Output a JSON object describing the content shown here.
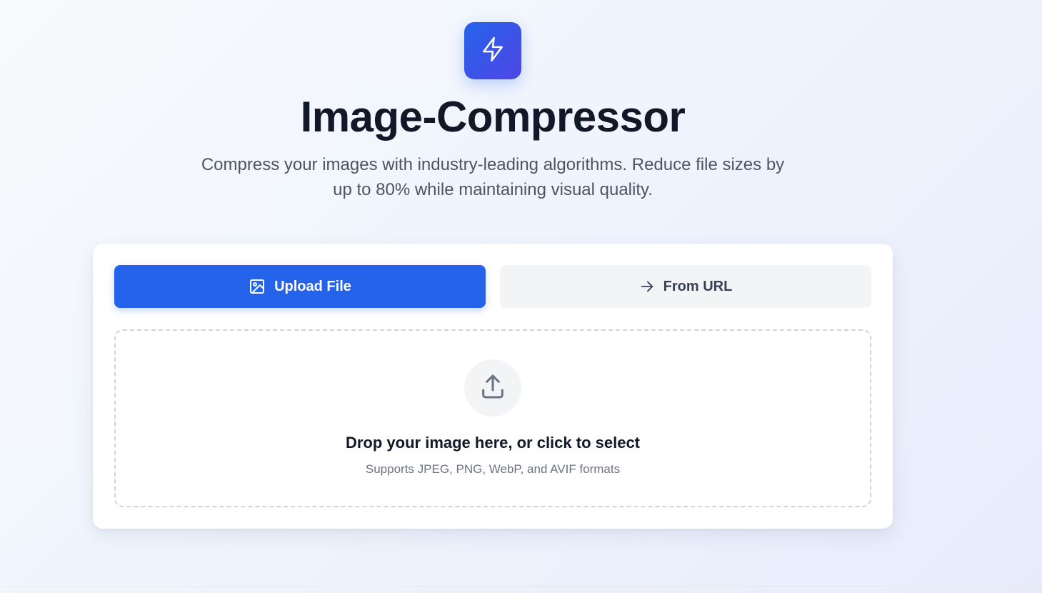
{
  "header": {
    "logo_icon": "lightning-bolt-icon",
    "title": "Image-Compressor",
    "subtitle": "Compress your images with industry-leading algorithms. Reduce file sizes by up to 80% while maintaining visual quality."
  },
  "tabs": [
    {
      "label": "Upload File",
      "icon": "image-icon",
      "active": true
    },
    {
      "label": "From URL",
      "icon": "arrow-right-icon",
      "active": false
    }
  ],
  "dropzone": {
    "icon": "upload-icon",
    "title": "Drop your image here, or click to select",
    "hint": "Supports JPEG, PNG, WebP, and AVIF formats"
  },
  "colors": {
    "primary": "#2563eb",
    "logo_gradient_end": "#4f46e5",
    "tab_inactive_bg": "#f3f4f6",
    "heading_text": "#111827",
    "muted_text": "#6b7280"
  }
}
